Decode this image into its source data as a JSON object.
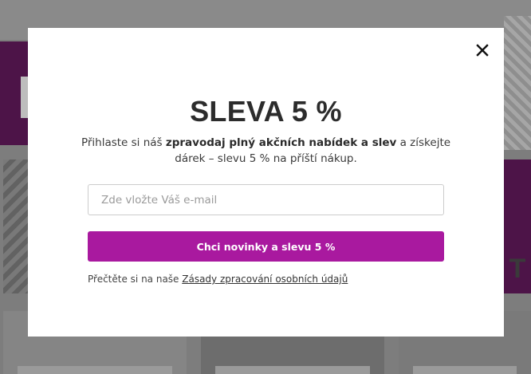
{
  "background": {
    "promo_letter": "T"
  },
  "popup": {
    "title": "SLEVA 5 %",
    "description_before": "Přihlaste si náš ",
    "description_bold": "zpravodaj plný akčních nabídek a slev",
    "description_after": " a získejte dárek – slevu 5 % na příští nákup.",
    "email_placeholder": "Zde vložte Váš e-mail",
    "email_value": "",
    "submit_label": "Chci novinky a slevu 5 %",
    "privacy_prefix": "Přečtěte si na naše ",
    "privacy_link": "Zásady zpracování osobních údajů",
    "close_icon": "close-icon",
    "colors": {
      "accent": "#a9199f",
      "title": "#2c2c2c",
      "overlay": "#7d7d7d"
    }
  }
}
